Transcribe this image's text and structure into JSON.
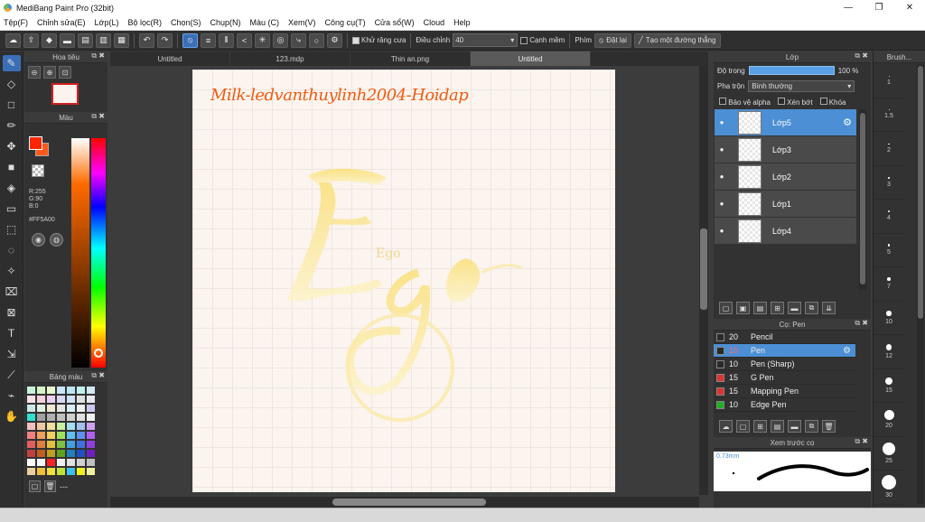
{
  "window": {
    "title": "MediBang Paint Pro (32bit)",
    "min": "—",
    "max": "❐",
    "close": "✕"
  },
  "menu": [
    "Tệp(F)",
    "Chỉnh sửa(E)",
    "Lớp(L)",
    "Bộ lọc(R)",
    "Chọn(S)",
    "Chụp(N)",
    "Màu (C)",
    "Xem(V)",
    "Công cụ(T)",
    "Cửa sổ(W)",
    "Cloud",
    "Help"
  ],
  "toolbar": {
    "antialias_label": "Khử răng cưa",
    "correction_label": "Điều chỉnh",
    "correction_value": "40",
    "edge_label": "Cạnh mềm",
    "keys_label": "Phím",
    "reset_label": "Đặt lại",
    "straight_label": "Tạo một đường thẳng"
  },
  "tabs": [
    "Untitled",
    "123.mdp",
    "Thin an.png",
    "Untitled"
  ],
  "navigator": {
    "title": "Hoa tiêu"
  },
  "color": {
    "title": "Màu",
    "r": "R:255",
    "g": "G:90",
    "b": "B:0",
    "hex": "#FF5A00",
    "primary": "#ff2500"
  },
  "palette": {
    "title": "Bảng màu",
    "swatches": [
      "#c9f0d8",
      "#d5f5c6",
      "#e8f8d0",
      "#c9e6f7",
      "#bfe6f5",
      "#c2f0ee",
      "#d4e8f5",
      "#f8e1e8",
      "#f5d0df",
      "#ead0f0",
      "#d8d8f0",
      "#cfe3f8",
      "#e0e0e0",
      "#e8e8f0",
      "#cce8e8",
      "#e0f0e0",
      "#f0e8d0",
      "#e6e6e6",
      "#d8f0f8",
      "#f0f0f0",
      "#c8c8f0",
      "#30e0d0",
      "#a0a0a0",
      "#b0b0b0",
      "#c0c0c0",
      "#d0d0d0",
      "#e0e0e0",
      "#f0f0f0",
      "#f0c0c0",
      "#f0c8a0",
      "#f0e0a0",
      "#c8f0a0",
      "#a0e0f0",
      "#a0c0f0",
      "#d0a0f0",
      "#f08080",
      "#f0a060",
      "#f0d060",
      "#a0e060",
      "#60c0f0",
      "#6090f0",
      "#b060f0",
      "#e06060",
      "#e08040",
      "#e0c040",
      "#80c040",
      "#40a0e0",
      "#4070e0",
      "#9040e0",
      "#c04040",
      "#c06020",
      "#c0a020",
      "#60a020",
      "#2080c0",
      "#2050c0",
      "#7020c0",
      "#ffffff",
      "#f8f8f8",
      "#ff2020",
      "#f0f0f0",
      "#e0e0e0",
      "#d0d0d0",
      "#c0c0c0",
      "#e8d0a0",
      "#f0c040",
      "#f0e040",
      "#c0e040",
      "#40c0f0",
      "#f0f020",
      "#f0f0a0"
    ],
    "footer_dash": "---"
  },
  "canvas": {
    "signature": "Milk-ledvanthuylinh2004-Hoidap",
    "art_text": "Ego"
  },
  "layers": {
    "title": "Lớp",
    "opacity_label": "Độ trong",
    "opacity_value": "100 %",
    "opacity_fraction": 1.0,
    "blend_label": "Pha trộn",
    "blend_value": "Bình thường",
    "protect_alpha": "Bảo vệ alpha",
    "clip": "Xén bớt",
    "lock": "Khóa",
    "items": [
      "Lớp5",
      "Lớp3",
      "Lớp2",
      "Lớp1",
      "Lớp4"
    ]
  },
  "brush": {
    "title": "Cọ: Pen",
    "items": [
      {
        "size": "20",
        "name": "Pencil",
        "color": "#2a2a2a"
      },
      {
        "size": "10",
        "name": "Pen",
        "color": "#2a2a2a"
      },
      {
        "size": "10",
        "name": "Pen (Sharp)",
        "color": "#2a2a2a"
      },
      {
        "size": "15",
        "name": "G Pen",
        "color": "#e03030"
      },
      {
        "size": "15",
        "name": "Mapping Pen",
        "color": "#e03030"
      },
      {
        "size": "10",
        "name": "Edge Pen",
        "color": "#20b020"
      }
    ],
    "preview_title": "Xem trước cọ",
    "preview_size": "0.73mm"
  },
  "brush_size": {
    "title": "Brush...",
    "sizes": [
      "1",
      "1.5",
      "2",
      "3",
      "4",
      "5",
      "7",
      "10",
      "12",
      "15",
      "20",
      "25",
      "30"
    ]
  }
}
